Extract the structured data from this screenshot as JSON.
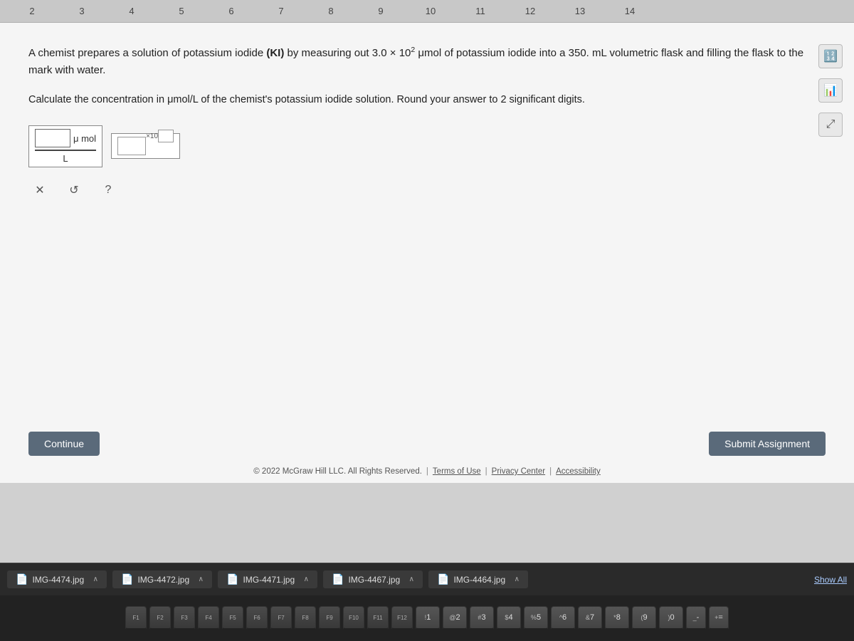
{
  "numbers": [
    "2",
    "3",
    "4",
    "5",
    "6",
    "7",
    "8",
    "9",
    "10",
    "11",
    "12",
    "13",
    "14"
  ],
  "problem": {
    "text": "A chemist prepares a solution of potassium iodide (KI) by measuring out 3.0 × 10² μmol of potassium iodide into a 350. mL volumetric flask and filling the flask to the mark with water.",
    "question": "Calculate the concentration in μmol/L of the chemist's potassium iodide solution. Round your answer to 2 significant digits.",
    "unit_numerator": "μ mol",
    "unit_denominator": "L"
  },
  "buttons": {
    "continue": "Continue",
    "submit": "Submit Assignment",
    "show_all": "Show All"
  },
  "footer": {
    "copyright": "© 2022 McGraw Hill LLC. All Rights Reserved.",
    "terms": "Terms of Use",
    "privacy": "Privacy Center",
    "accessibility": "Accessibility"
  },
  "downloads": [
    {
      "name": "IMG-4474.jpg"
    },
    {
      "name": "IMG-4472.jpg"
    },
    {
      "name": "IMG-4471.jpg"
    },
    {
      "name": "IMG-4467.jpg"
    },
    {
      "name": "IMG-4464.jpg"
    }
  ],
  "keyboard": {
    "fn_row": [
      "F1",
      "F2",
      "F3",
      "F4",
      "F5",
      "F6",
      "F7",
      "F8",
      "F9",
      "F10",
      "F11",
      "F12"
    ],
    "number_row": [
      "1",
      "2",
      "3",
      "4",
      "5",
      "6",
      "7",
      "8",
      "9",
      "0"
    ],
    "symbols": [
      "%",
      "^",
      "&",
      "*",
      "(",
      ")",
      "-",
      "+"
    ]
  },
  "icons": {
    "calculator": "🔢",
    "chart": "📊",
    "expand": "⤢"
  }
}
